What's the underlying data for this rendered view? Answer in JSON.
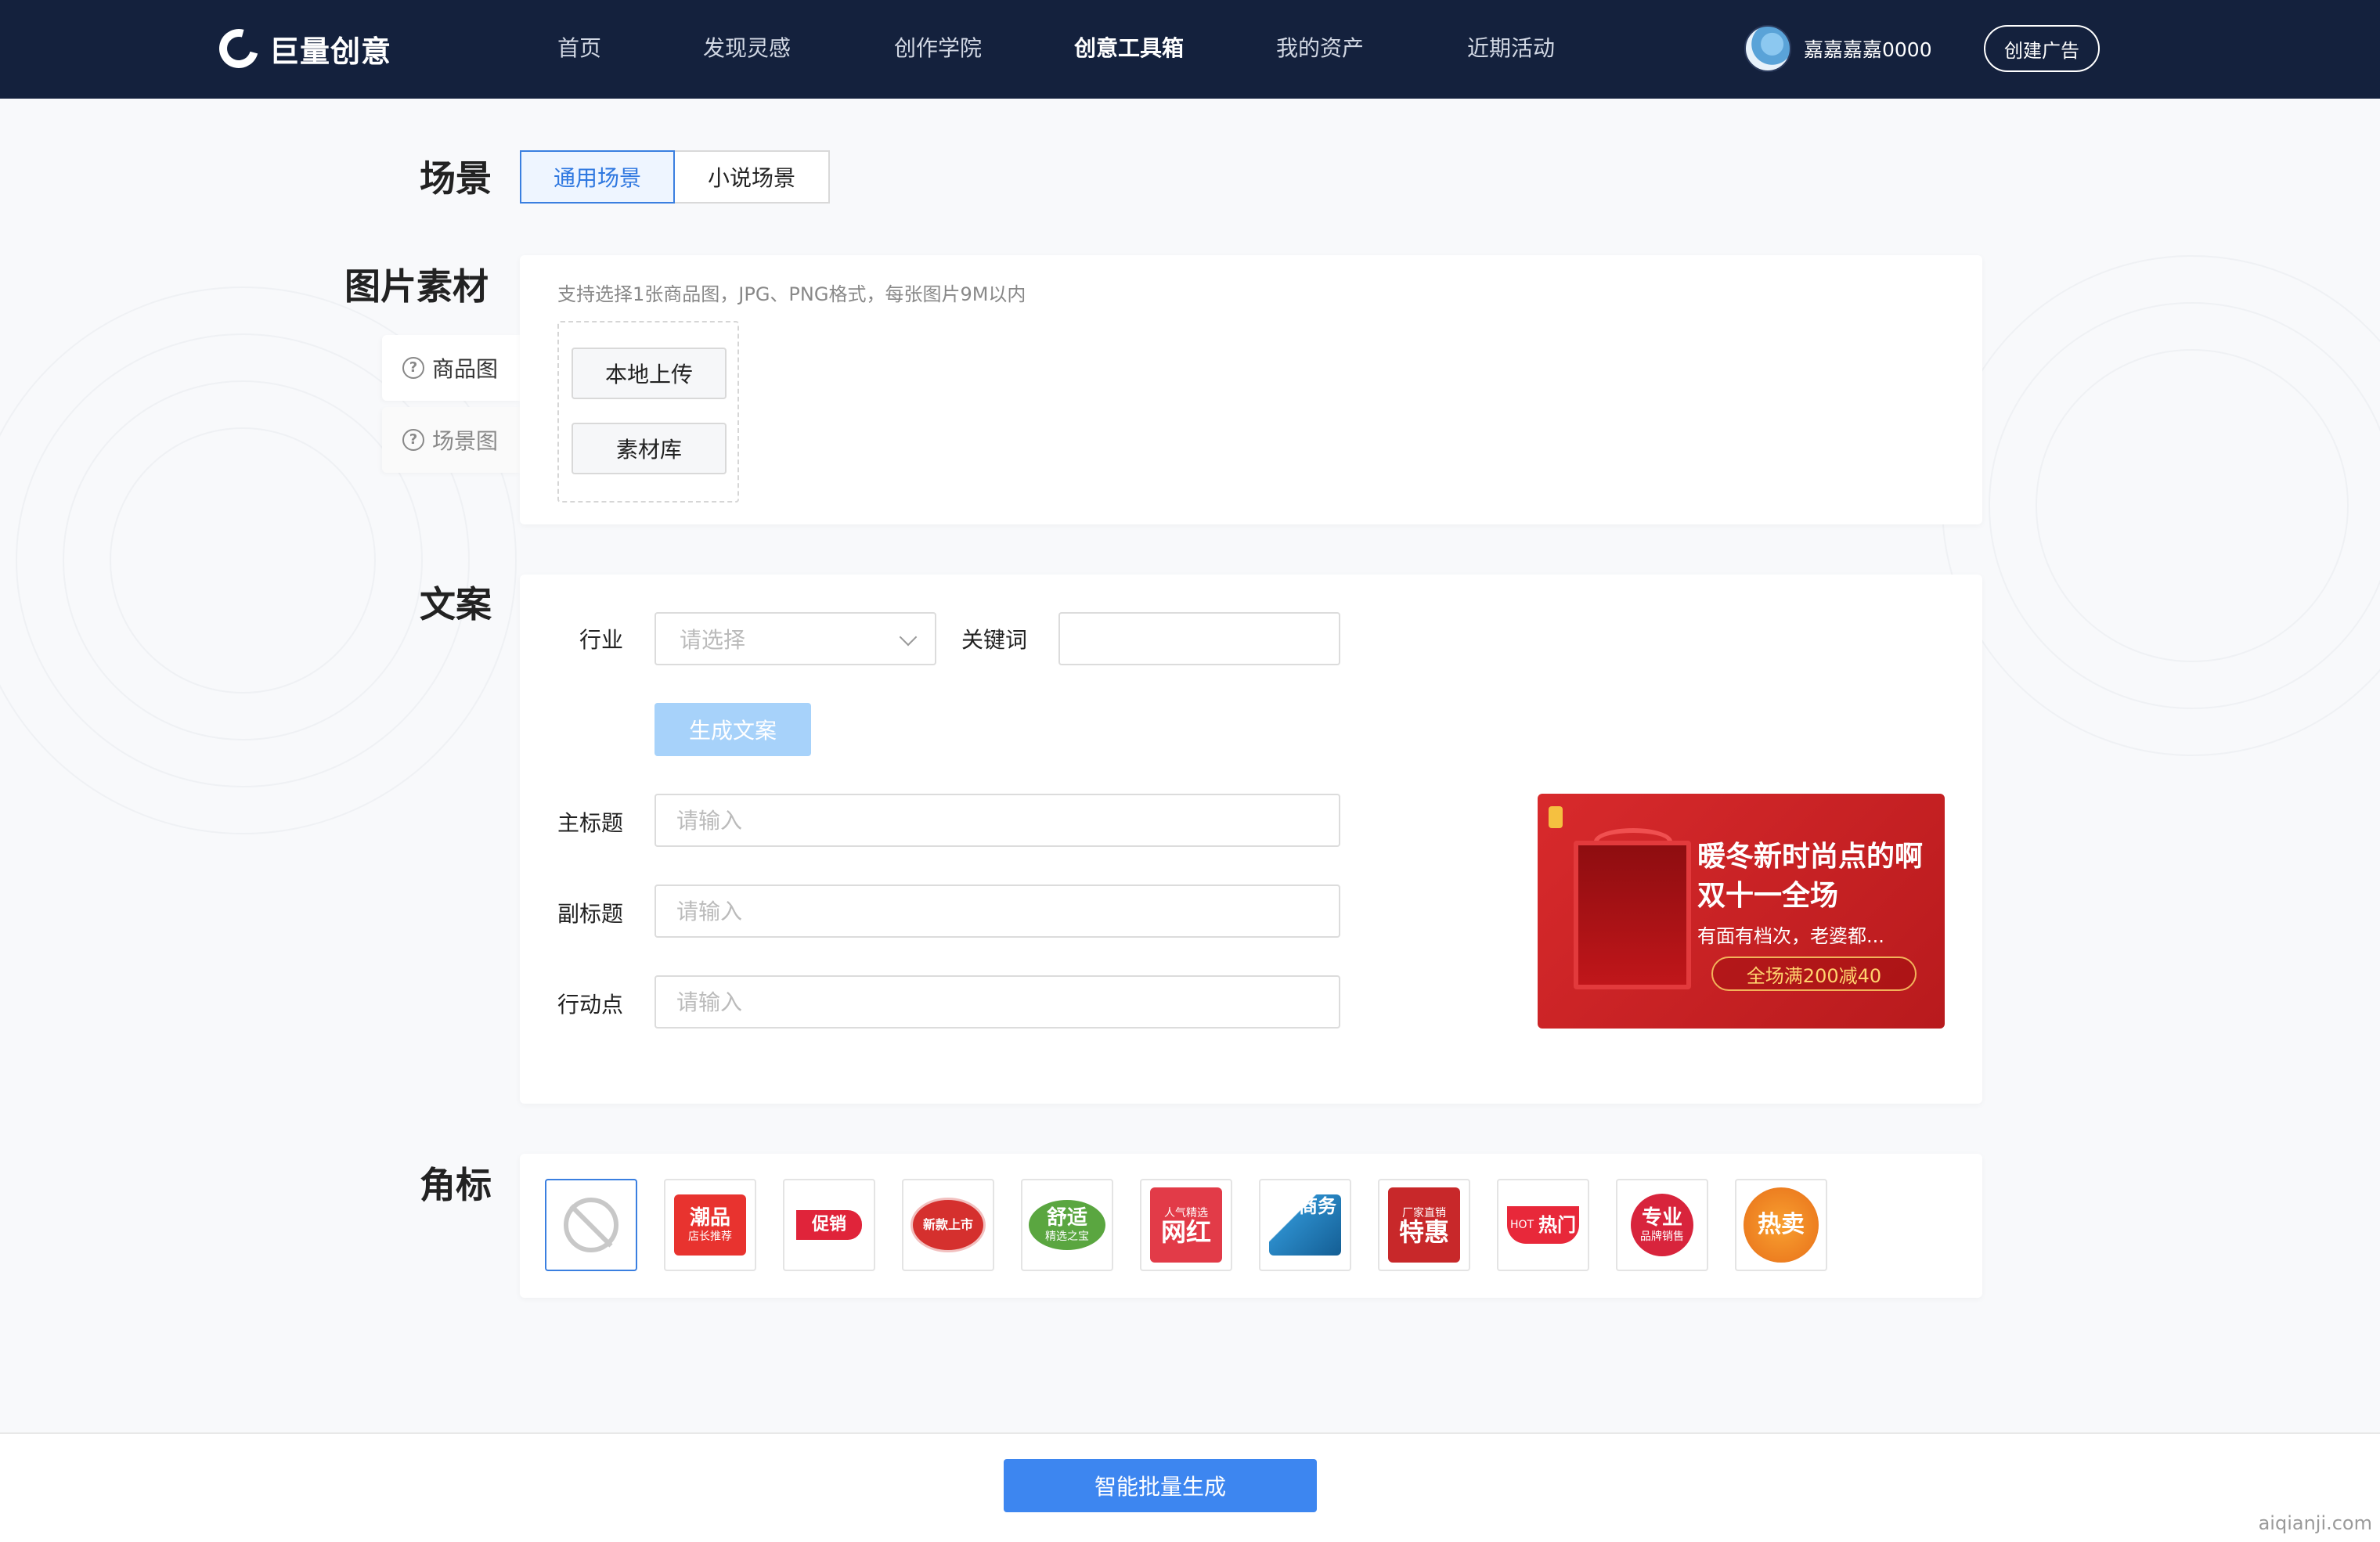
{
  "header": {
    "brand": "巨量创意",
    "nav": [
      "首页",
      "发现灵感",
      "创作学院",
      "创意工具箱",
      "我的资产",
      "近期活动"
    ],
    "active_nav": "创意工具箱",
    "user_name": "嘉嘉嘉嘉0000",
    "create_ad": "创建广告"
  },
  "scene": {
    "label": "场景",
    "options": [
      "通用场景",
      "小说场景"
    ],
    "selected": "通用场景"
  },
  "image_material": {
    "label": "图片素材",
    "tabs": [
      "商品图",
      "场景图"
    ],
    "active_tab": "商品图",
    "hint": "支持选择1张商品图，JPG、PNG格式，每张图片9M以内",
    "local_upload": "本地上传",
    "library": "素材库"
  },
  "copy": {
    "label": "文案",
    "industry_label": "行业",
    "industry_placeholder": "请选择",
    "keyword_label": "关键词",
    "generate": "生成文案",
    "main_title_label": "主标题",
    "sub_title_label": "副标题",
    "action_label": "行动点",
    "input_placeholder": "请输入"
  },
  "preview": {
    "title_line1": "暖冬新时尚点的啊",
    "title_line2": "双十一全场",
    "subtitle": "有面有档次，老婆都...",
    "promo": "全场满200减40"
  },
  "corner_tag": {
    "label": "角标",
    "tags": [
      {
        "name": "none",
        "text": "",
        "sub": ""
      },
      {
        "name": "trend",
        "text": "潮品",
        "sub": "店长推荐"
      },
      {
        "name": "promo",
        "text": "促销",
        "sub": ""
      },
      {
        "name": "new",
        "text": "新款上市",
        "sub": ""
      },
      {
        "name": "comfort",
        "text": "舒适",
        "sub": "精选之宝"
      },
      {
        "name": "influencer",
        "text": "网红",
        "sub": "人气精选"
      },
      {
        "name": "business",
        "text": "商务",
        "sub": ""
      },
      {
        "name": "special",
        "text": "特惠",
        "sub": "厂家直销"
      },
      {
        "name": "hot",
        "text": "热门",
        "sub": "HOT"
      },
      {
        "name": "pro",
        "text": "专业",
        "sub": "品牌销售"
      },
      {
        "name": "best",
        "text": "热卖",
        "sub": ""
      }
    ]
  },
  "footer": {
    "generate_batch": "智能批量生成",
    "watermark": "aiqianji.com"
  }
}
